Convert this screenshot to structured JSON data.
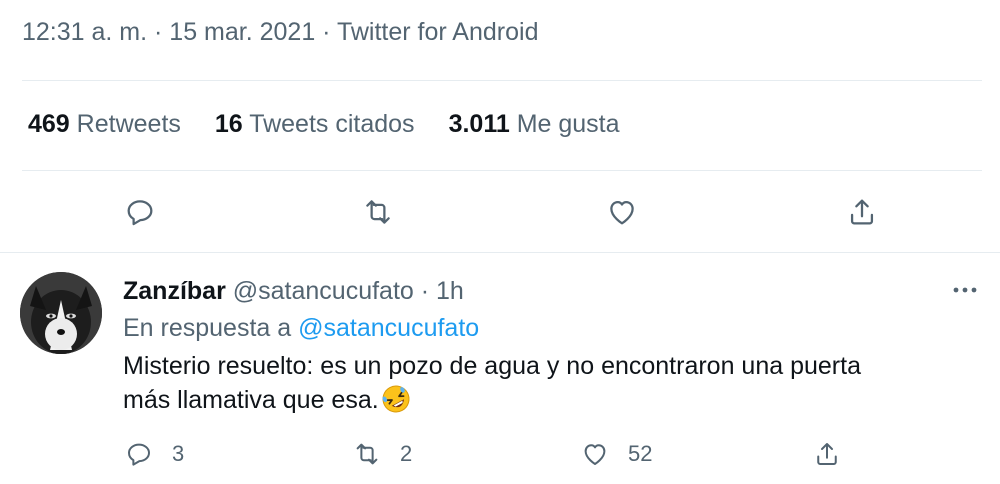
{
  "tweet": {
    "timestamp": "12:31 a. m. · 15 mar. 2021 · Twitter for Android",
    "stats": [
      {
        "count": "469",
        "label": "Retweets"
      },
      {
        "count": "16",
        "label": "Tweets citados"
      },
      {
        "count": "3.011",
        "label": "Me gusta"
      }
    ],
    "actions": [
      "reply-icon",
      "retweet-icon",
      "like-icon",
      "share-icon"
    ]
  },
  "reply": {
    "display_name": "Zanzíbar",
    "handle": "@satancucufato",
    "time": "1h",
    "separator": " · ",
    "reply_to_prefix": "En respuesta a ",
    "reply_to_handle": "@satancucufato",
    "text_line1": "Misterio resuelto: es un pozo de agua y no encontraron una puerta",
    "text_line2": "más llamativa que esa.",
    "emoji": "rolling-on-floor-laughing-emoji",
    "counts": {
      "replies": "3",
      "retweets": "2",
      "likes": "52"
    }
  },
  "colors": {
    "text": "#0f1419",
    "secondary": "#536471",
    "accent": "#1d9bf0",
    "divider": "#e6ecf0"
  }
}
